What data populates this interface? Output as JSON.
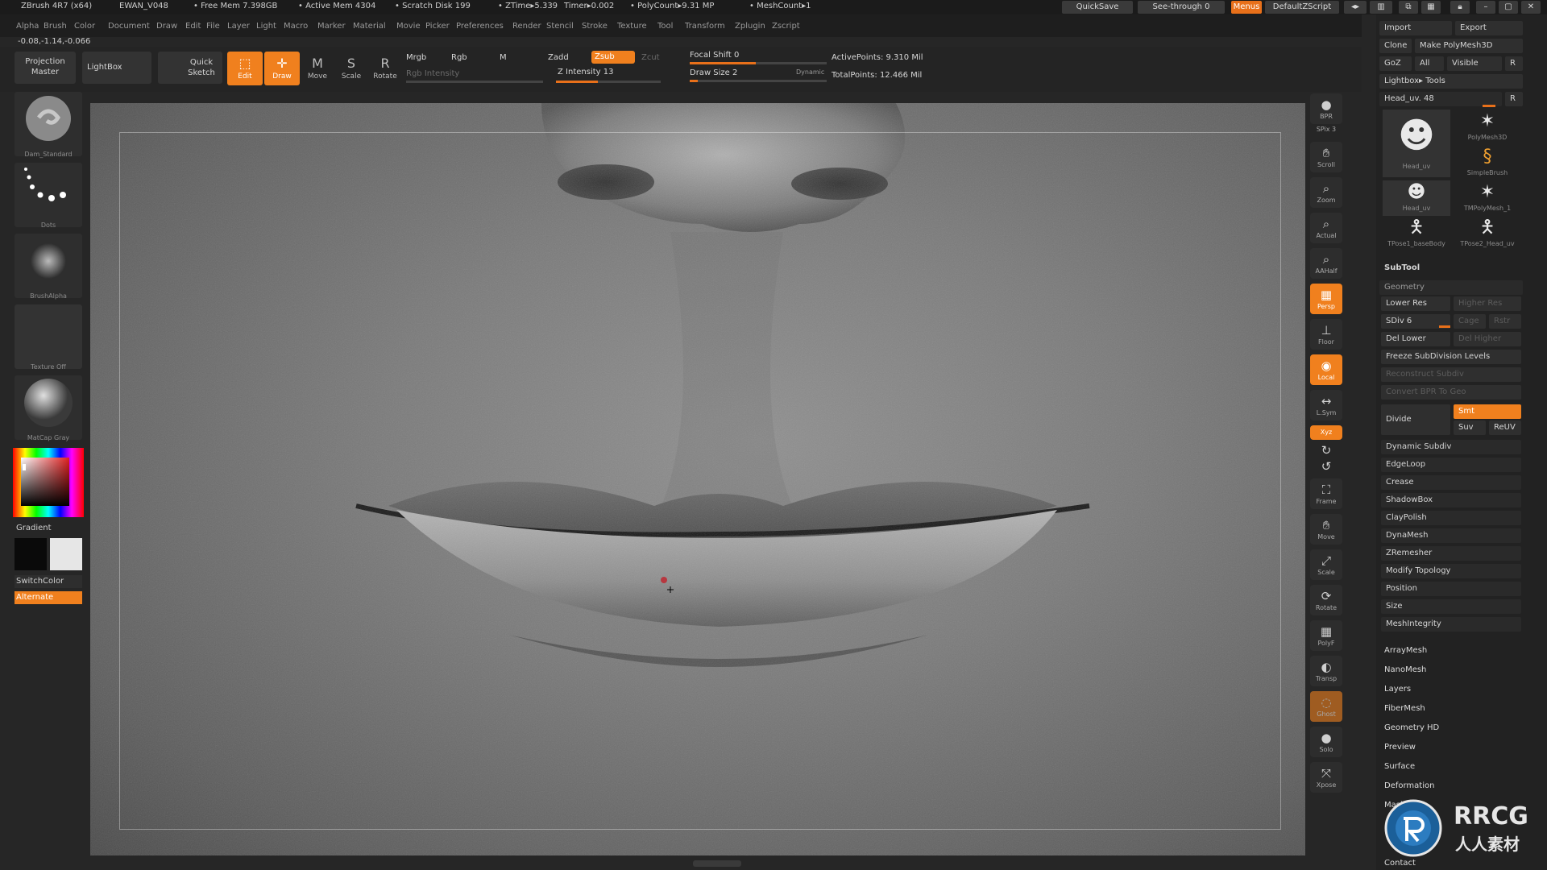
{
  "titlebar": {
    "app": "ZBrush 4R7 (x64)",
    "file": "EWAN_V048",
    "free_mem": "• Free Mem 7.398GB",
    "active_mem": "• Active Mem 4304",
    "scratch_disk": "• Scratch Disk 199",
    "ztime": "• ZTime▸5.339",
    "timer": "Timer▸0.002",
    "polycount": "• PolyCount▸9.31 MP",
    "meshcount": "• MeshCount▸1",
    "quicksave": "QuickSave",
    "seethrough": "See-through 0",
    "menus": "Menus",
    "defaultzscript": "DefaultZScript"
  },
  "menu": [
    "Alpha",
    "Brush",
    "Color",
    "Document",
    "Draw",
    "Edit",
    "File",
    "Layer",
    "Light",
    "Macro",
    "Marker",
    "Material",
    "Movie",
    "Picker",
    "Preferences",
    "Render",
    "Stencil",
    "Stroke",
    "Texture",
    "Tool",
    "Transform",
    "Zplugin",
    "Zscript"
  ],
  "coords": "-0.08,-1.14,-0.066",
  "shelf": {
    "projection_master": "Projection Master",
    "lightbox": "LightBox",
    "quick_sketch": "Quick Sketch",
    "edit": "Edit",
    "draw": "Draw",
    "move": "Move",
    "scale": "Scale",
    "rotate": "Rotate",
    "mrgb": "Mrgb",
    "rgb": "Rgb",
    "m": "M",
    "rgb_intensity": "Rgb Intensity",
    "zadd": "Zadd",
    "zsub": "Zsub",
    "zcut": "Zcut",
    "z_intensity": "Z Intensity 13",
    "focal_shift": "Focal Shift 0",
    "draw_size": "Draw Size 2",
    "dynamic": "Dynamic",
    "active_points": "ActivePoints: 9.310 Mil",
    "total_points": "TotalPoints: 12.466 Mil"
  },
  "left_tray": {
    "brush": "Dam_Standard",
    "stroke": "Dots",
    "alpha": "BrushAlpha",
    "texture": "Texture Off",
    "material": "MatCap Gray",
    "gradient": "Gradient",
    "switchcolor": "SwitchColor",
    "alternate": "Alternate"
  },
  "right_shelf": [
    "BPR",
    "SPix 3",
    "Scroll",
    "Zoom",
    "Actual",
    "AAHalf",
    "Persp",
    "Floor",
    "Local",
    "L.Sym",
    "Xyz",
    "Frame",
    "Move",
    "Scale",
    "Rotate",
    "PolyF",
    "Transp",
    "Ghost",
    "Solo",
    "Xpose"
  ],
  "right_panel": {
    "import": "Import",
    "export": "Export",
    "clone": "Clone",
    "make_polymesh": "Make PolyMesh3D",
    "goz": "GoZ",
    "all": "All",
    "visible": "Visible",
    "r": "R",
    "lightbox_tools": "Lightbox▸ Tools",
    "current_tool": "Head_uv. 48",
    "tools": [
      {
        "label": "Head_uv",
        "icon": "head-icon"
      },
      {
        "label": "PolyMesh3D",
        "icon": "star-icon"
      },
      {
        "label": "SimpleBrush",
        "icon": "simplebrush-icon"
      },
      {
        "label": "Head_uv",
        "icon": "head-icon"
      },
      {
        "label": "TMPolyMesh_1",
        "icon": "star-icon"
      },
      {
        "label": "TPose1_baseBody",
        "icon": "figure-icon"
      },
      {
        "label": "TPose2_Head_uv",
        "icon": "figure-icon"
      }
    ],
    "subtool": "SubTool",
    "geometry": "Geometry",
    "lower_res": "Lower Res",
    "higher_res": "Higher Res",
    "sdiv": "SDiv 6",
    "cage": "Cage",
    "rstr": "Rstr",
    "del_lower": "Del Lower",
    "del_higher": "Del Higher",
    "freeze": "Freeze SubDivision Levels",
    "reconstruct": "Reconstruct Subdiv",
    "convert_bpr": "Convert BPR To Geo",
    "divide": "Divide",
    "smt": "Smt",
    "suv": "Suv",
    "reuv": "ReUV",
    "geometry_items": [
      "Dynamic Subdiv",
      "EdgeLoop",
      "Crease",
      "ShadowBox",
      "ClayPolish",
      "DynaMesh",
      "ZRemesher",
      "Modify Topology",
      "Position",
      "Size",
      "MeshIntegrity"
    ],
    "tool_items": [
      "ArrayMesh",
      "NanoMesh",
      "Layers",
      "FiberMesh",
      "Geometry HD",
      "Preview",
      "Surface",
      "Deformation",
      "Masking",
      "Contact"
    ]
  },
  "watermark": {
    "brand": "RRCG",
    "sub": "人人素材"
  },
  "colors": {
    "accent": "#f0801e",
    "panel": "#222222",
    "canvas": "#7a7a7a"
  }
}
